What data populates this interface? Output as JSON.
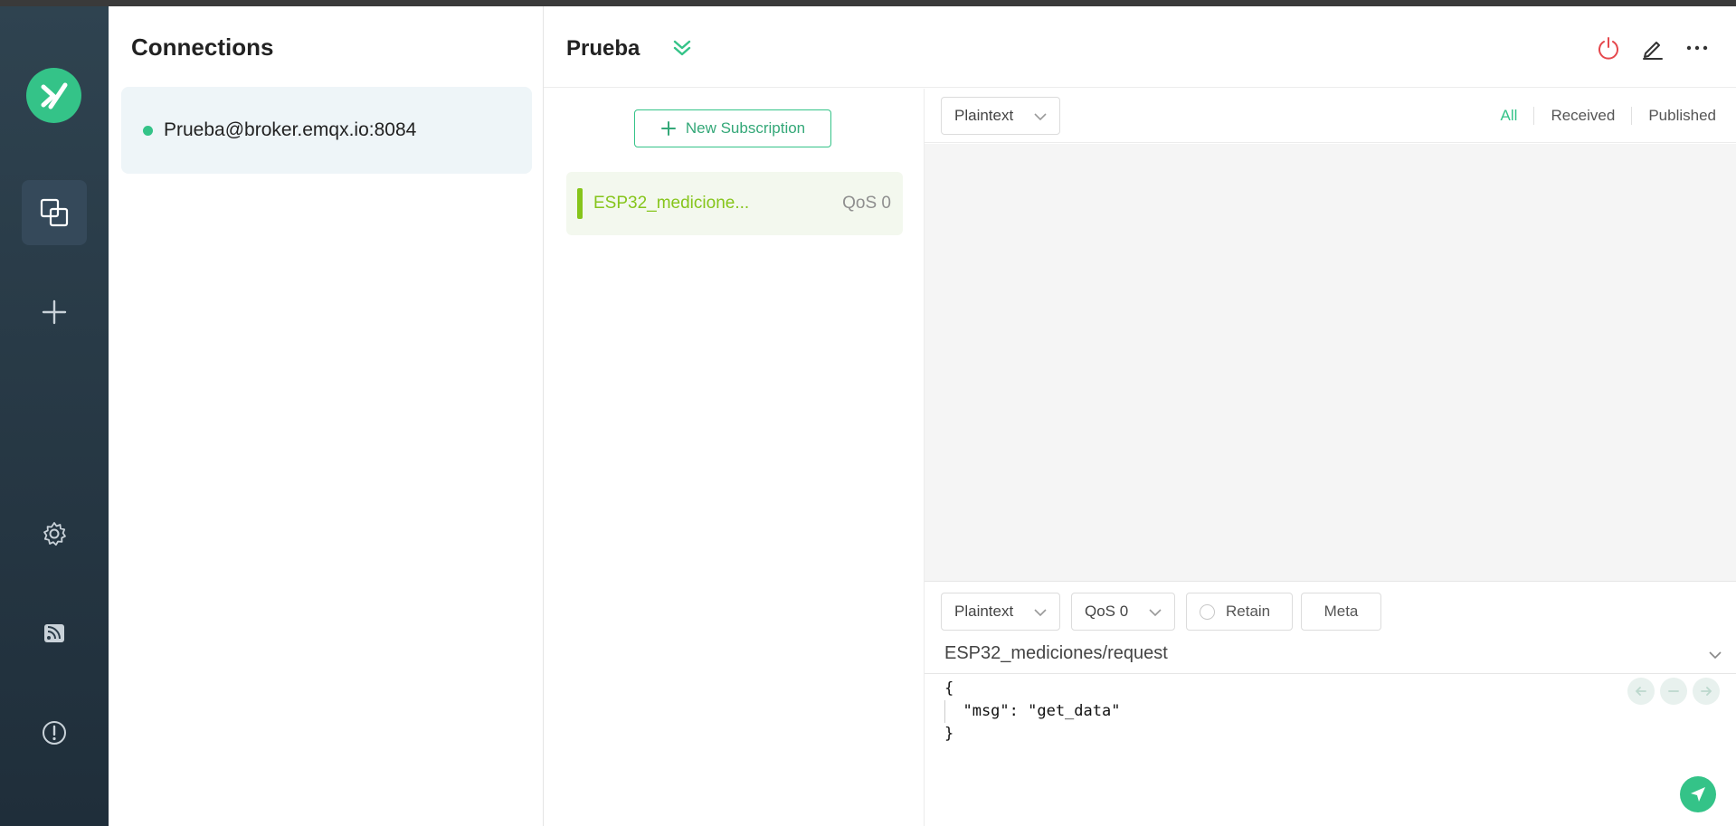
{
  "colors": {
    "accent": "#34c388",
    "sidebar_top": "#2f4350",
    "sidebar_bottom": "#1f2e3a",
    "subscription": "#86c51b",
    "disconnect": "#e5484d"
  },
  "leftnav": {
    "logo_icon": "emqx-logo-icon",
    "items": [
      {
        "icon": "connections-icon",
        "active": true
      },
      {
        "icon": "plus-icon",
        "active": false
      },
      {
        "icon": "gear-icon",
        "active": false
      },
      {
        "icon": "feed-icon",
        "active": false
      },
      {
        "icon": "info-icon",
        "active": false
      }
    ]
  },
  "connections": {
    "title": "Connections",
    "items": [
      {
        "name": "Prueba@broker.emqx.io:8084",
        "status": "connected"
      }
    ]
  },
  "header": {
    "title": "Prueba",
    "icons": [
      "collapse-icon",
      "power-icon",
      "edit-icon",
      "more-icon"
    ]
  },
  "subscriptions": {
    "new_label": "New Subscription",
    "items": [
      {
        "topic": "ESP32_medicione...",
        "qos": "QoS 0"
      }
    ]
  },
  "messages": {
    "format": "Plaintext",
    "filters": [
      "All",
      "Received",
      "Published"
    ],
    "active_filter": "All"
  },
  "publish": {
    "format": "Plaintext",
    "qos": "QoS 0",
    "retain_label": "Retain",
    "meta_label": "Meta",
    "topic": "ESP32_mediciones/request",
    "payload_lines": [
      "{",
      "  \"msg\": \"get_data\"",
      "}"
    ]
  }
}
